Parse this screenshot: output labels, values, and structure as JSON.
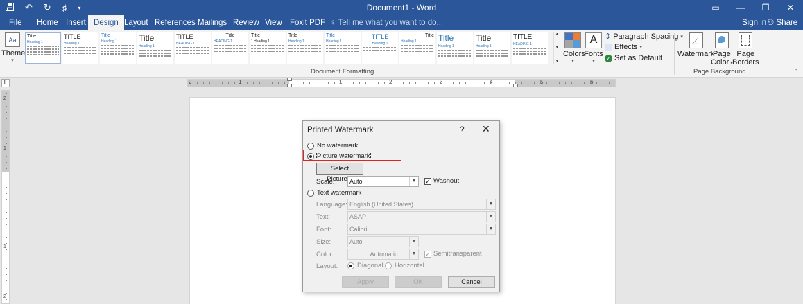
{
  "window": {
    "title": "Document1 - Word",
    "qat_icons": [
      "save-icon",
      "undo-icon",
      "redo-icon",
      "touch-mode-icon",
      "customize-qat-icon"
    ]
  },
  "tabs": [
    {
      "label": "File"
    },
    {
      "label": "Home"
    },
    {
      "label": "Insert"
    },
    {
      "label": "Design"
    },
    {
      "label": "Layout"
    },
    {
      "label": "References"
    },
    {
      "label": "Mailings"
    },
    {
      "label": "Review"
    },
    {
      "label": "View"
    },
    {
      "label": "Foxit PDF"
    }
  ],
  "active_tab": "Design",
  "tell_me": "Tell me what you want to do...",
  "sign_in": "Sign in",
  "share": "Share",
  "ribbon": {
    "themes_label": "Themes",
    "style_titles": [
      "Title",
      "TITLE",
      "Title",
      "Title",
      "TITLE",
      "Title",
      "Title",
      "Title",
      "Title",
      "TITLE",
      "Title",
      "Title",
      "Title",
      "TITLE"
    ],
    "style_headings": [
      "Heading 1",
      "Heading 1",
      "Heading 1",
      "Heading 1",
      "HEADING 1",
      "HEADING 1",
      "1 Heading 1",
      "Heading 1",
      "Heading 1",
      "Heading 1",
      "Heading 1",
      "Heading 1",
      "Heading 1",
      "HEADING 1"
    ],
    "document_formatting_label": "Document Formatting",
    "colors_label": "Colors",
    "fonts_label": "Fonts",
    "paragraph_spacing": "Paragraph Spacing",
    "effects": "Effects",
    "set_as_default": "Set as Default",
    "watermark": "Watermark",
    "page_color_1": "Page",
    "page_color_2": "Color",
    "page_borders_1": "Page",
    "page_borders_2": "Borders",
    "page_background_label": "Page Background",
    "theme_colors": [
      "#4472c4",
      "#ed7d31",
      "#a5a5a5",
      "#5b9bd5"
    ]
  },
  "ruler": {
    "h_labels": [
      "2",
      "1",
      "1",
      "2",
      "3",
      "4",
      "5",
      "6"
    ],
    "v_labels": [
      "2",
      "1",
      "1",
      "2"
    ]
  },
  "dialog": {
    "title": "Printed Watermark",
    "help": "?",
    "close": "✕",
    "no_watermark": "No watermark",
    "picture_watermark": "Picture watermark",
    "select_picture": "Select Picture...",
    "scale_label": "Scale:",
    "scale_value": "Auto",
    "washout": "Washout",
    "washout_checked": true,
    "text_watermark": "Text watermark",
    "language_label": "Language:",
    "language_value": "English (United States)",
    "text_label": "Text:",
    "text_value": "ASAP",
    "font_label": "Font:",
    "font_value": "Calibri",
    "size_label": "Size:",
    "size_value": "Auto",
    "color_label": "Color:",
    "color_value": "Automatic",
    "semitransparent": "Semitransparent",
    "layout_label": "Layout:",
    "diagonal": "Diagonal",
    "horizontal": "Horizontal",
    "apply": "Apply",
    "ok": "OK",
    "cancel": "Cancel"
  }
}
